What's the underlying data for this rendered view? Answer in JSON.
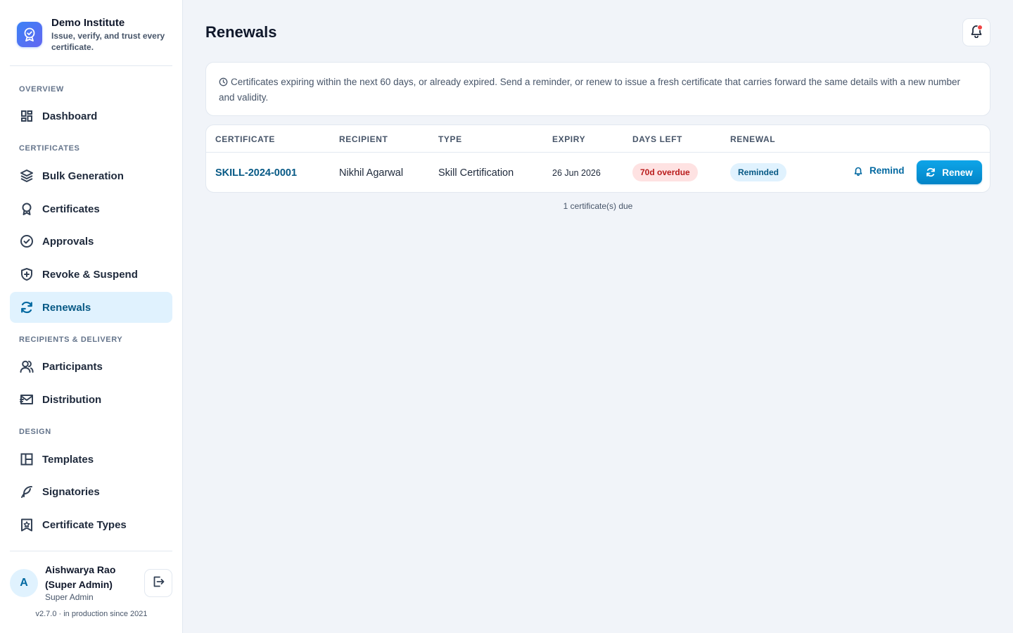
{
  "brand": {
    "name": "Demo Institute",
    "tagline": "Issue, verify, and trust every certificate."
  },
  "sidebar": {
    "sections": [
      {
        "label": "OVERVIEW"
      },
      {
        "label": "CERTIFICATES"
      },
      {
        "label": "RECIPIENTS & DELIVERY"
      },
      {
        "label": "DESIGN"
      }
    ],
    "items": [
      {
        "label": "Dashboard",
        "icon": "dashboard-icon"
      },
      {
        "label": "Bulk Generation",
        "icon": "layers-icon"
      },
      {
        "label": "Certificates",
        "icon": "award-icon"
      },
      {
        "label": "Approvals",
        "icon": "check-circle-icon"
      },
      {
        "label": "Revoke & Suspend",
        "icon": "shield-plus-icon"
      },
      {
        "label": "Renewals",
        "icon": "refresh-icon",
        "active": true
      },
      {
        "label": "Participants",
        "icon": "users-icon"
      },
      {
        "label": "Distribution",
        "icon": "mail-send-icon"
      },
      {
        "label": "Templates",
        "icon": "layout-icon"
      },
      {
        "label": "Signatories",
        "icon": "feather-icon"
      },
      {
        "label": "Certificate Types",
        "icon": "bookmark-star-icon"
      }
    ]
  },
  "user": {
    "initial": "A",
    "name": "Aishwarya Rao (Super Admin)",
    "role": "Super Admin"
  },
  "version": "v2.7.0 · in production since 2021",
  "page": {
    "title": "Renewals"
  },
  "info": {
    "text": "Certificates expiring within the next 60 days, or already expired. Send a reminder, or renew to issue a fresh certificate that carries forward the same details with a new number and validity."
  },
  "table": {
    "columns": [
      "CERTIFICATE",
      "RECIPIENT",
      "TYPE",
      "EXPIRY",
      "DAYS LEFT",
      "RENEWAL"
    ],
    "rows": [
      {
        "certificate": "SKILL-2024-0001",
        "recipient": "Nikhil Agarwal",
        "type": "Skill Certification",
        "expiry": "26 Jun 2026",
        "days_left": "70d overdue",
        "renewal": "Reminded",
        "remind_label": "Remind",
        "renew_label": "Renew"
      }
    ]
  },
  "footer": {
    "count_text": "1 certificate(s) due"
  },
  "colors": {
    "accent": "#0284c7",
    "active_bg": "#e0f2fe",
    "overdue_bg": "#fee2e2",
    "overdue_text": "#b91c1c",
    "notification_dot": "#ef4444"
  }
}
